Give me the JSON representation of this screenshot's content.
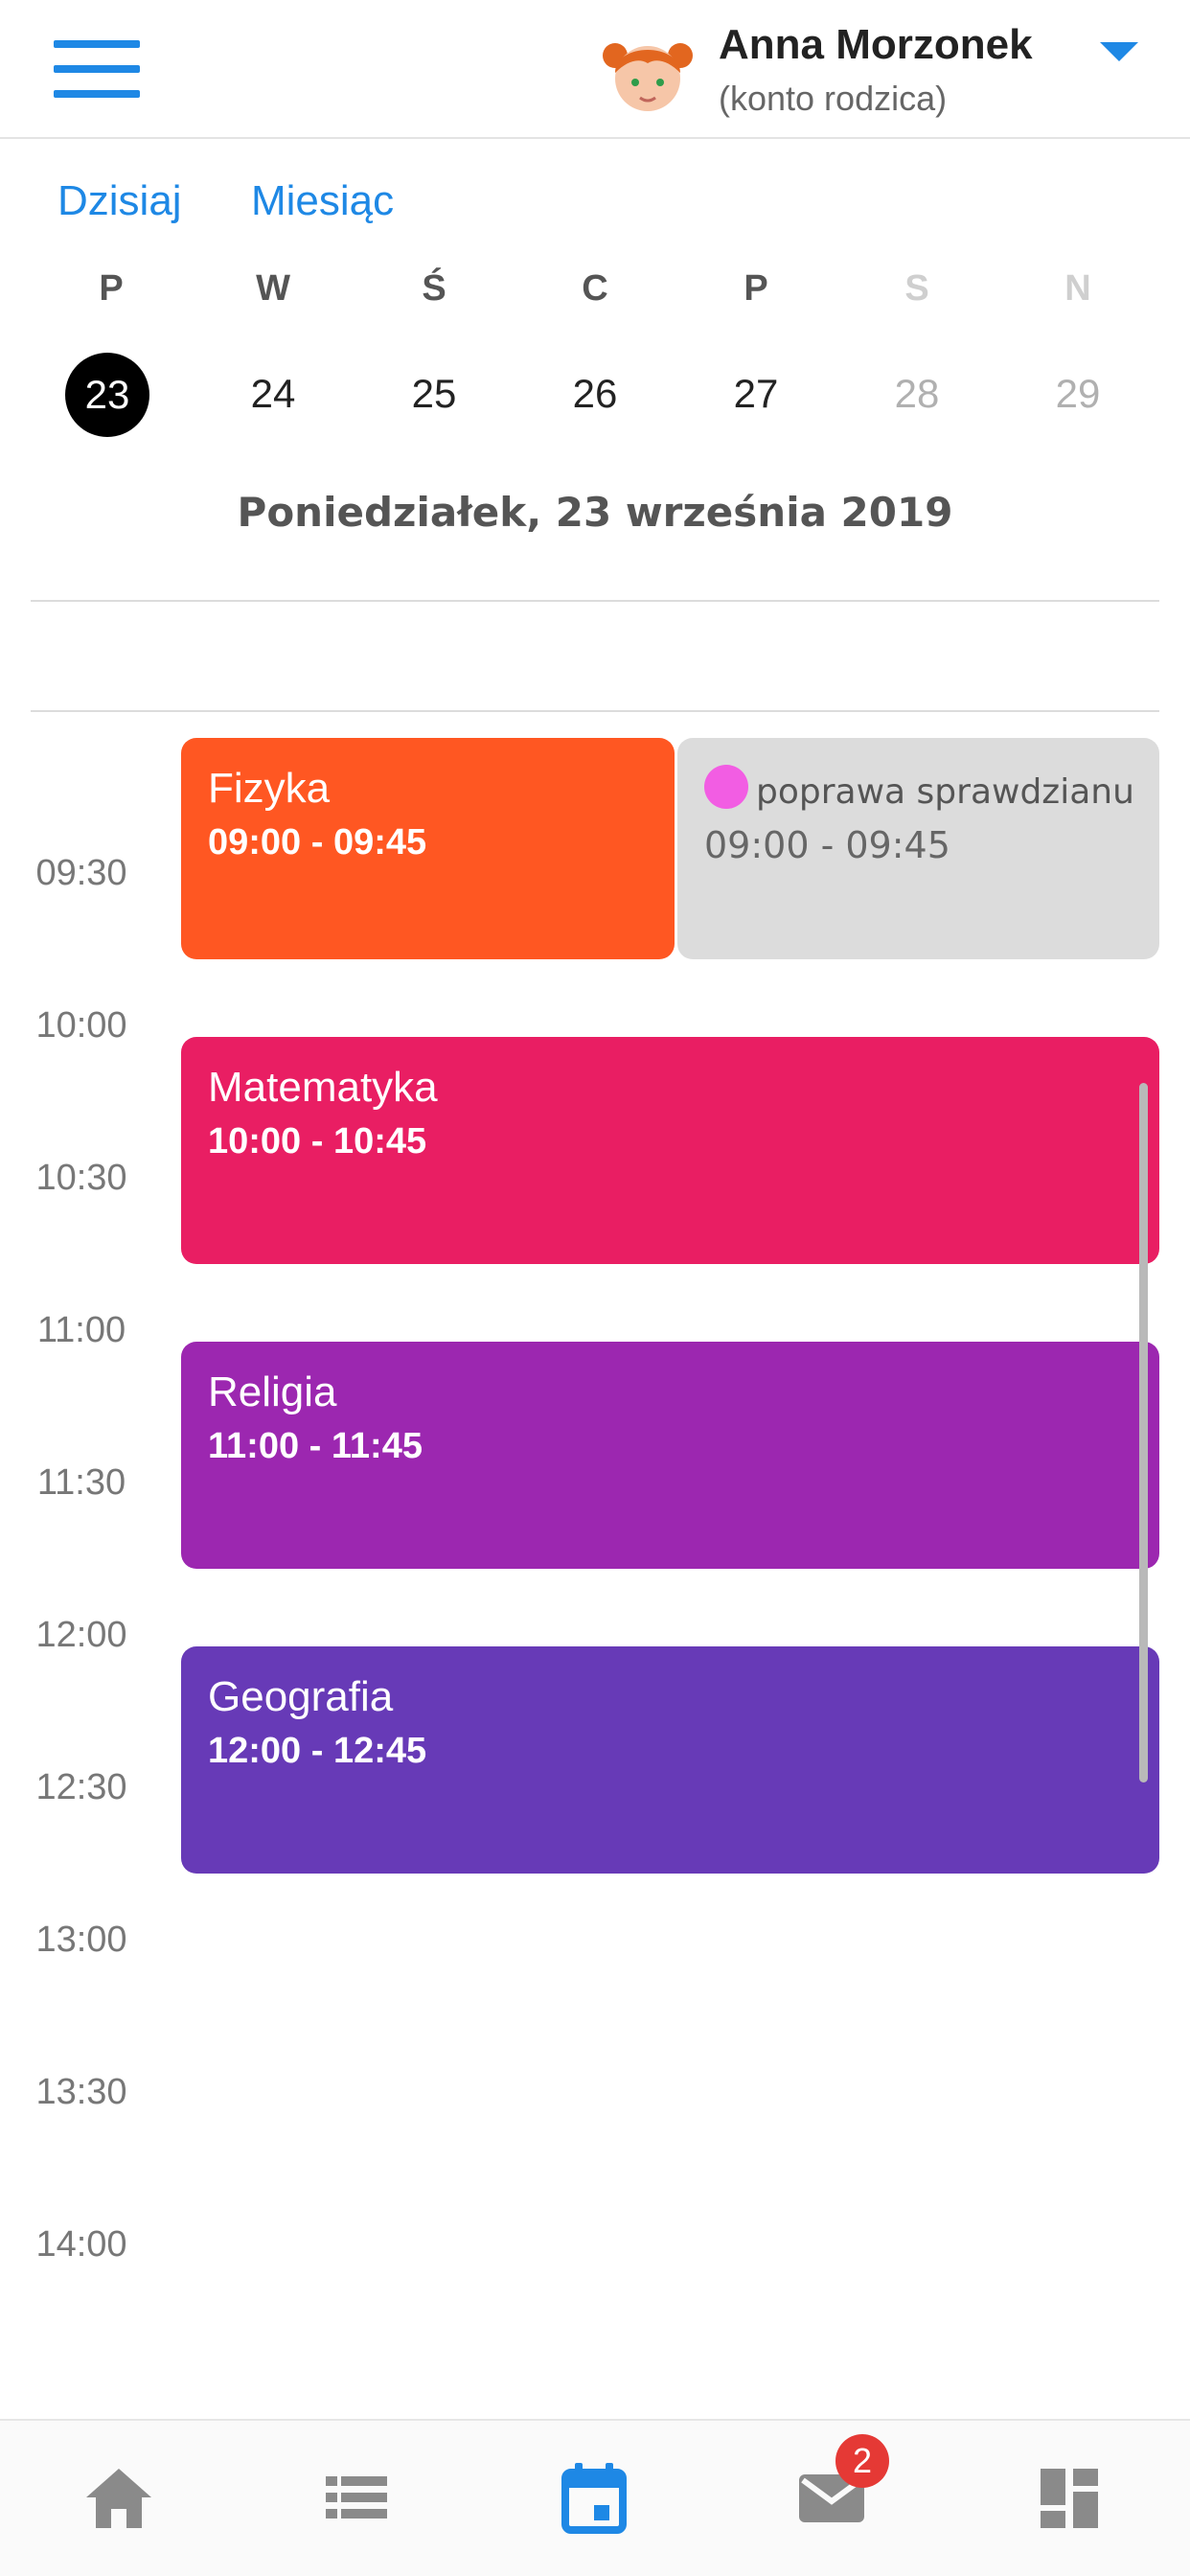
{
  "header": {
    "user_name": "Anna Morzonek",
    "user_role": "(konto rodzica)",
    "menu_icon": "hamburger-menu-icon",
    "dropdown_icon": "caret-down-icon",
    "accent_color": "#1e88e5"
  },
  "views": {
    "today_label": "Dzisiaj",
    "month_label": "Miesiąc"
  },
  "week": {
    "days": [
      {
        "letter": "P",
        "number": "23",
        "selected": true,
        "weekend": false
      },
      {
        "letter": "W",
        "number": "24",
        "selected": false,
        "weekend": false
      },
      {
        "letter": "Ś",
        "number": "25",
        "selected": false,
        "weekend": false
      },
      {
        "letter": "C",
        "number": "26",
        "selected": false,
        "weekend": false
      },
      {
        "letter": "P",
        "number": "27",
        "selected": false,
        "weekend": false
      },
      {
        "letter": "S",
        "number": "28",
        "selected": false,
        "weekend": true
      },
      {
        "letter": "N",
        "number": "29",
        "selected": false,
        "weekend": true
      }
    ]
  },
  "selected_date": "Poniedziałek, 23 września 2019",
  "timeline": {
    "hours": [
      "09:30",
      "10:00",
      "10:30",
      "11:00",
      "11:30",
      "12:00",
      "12:30",
      "13:00",
      "13:30",
      "14:00"
    ],
    "events": [
      {
        "title": "Fizyka",
        "time": "09:00 - 09:45",
        "color": "#ff5722"
      },
      {
        "title": "poprawa sprawdzianu",
        "time": "09:00 - 09:45",
        "color": "#dcdcdc",
        "dot_color": "#f25de3"
      },
      {
        "title": "Matematyka",
        "time": "10:00 - 10:45",
        "color": "#e91e63"
      },
      {
        "title": "Religia",
        "time": "11:00 - 11:45",
        "color": "#9c27b0"
      },
      {
        "title": "Geografia",
        "time": "12:00 - 12:45",
        "color": "#673ab7"
      }
    ]
  },
  "bottom_nav": {
    "items": [
      "home-icon",
      "list-icon",
      "calendar-icon",
      "mail-icon",
      "dashboard-icon"
    ],
    "active": "calendar-icon",
    "mail_badge": "2"
  }
}
